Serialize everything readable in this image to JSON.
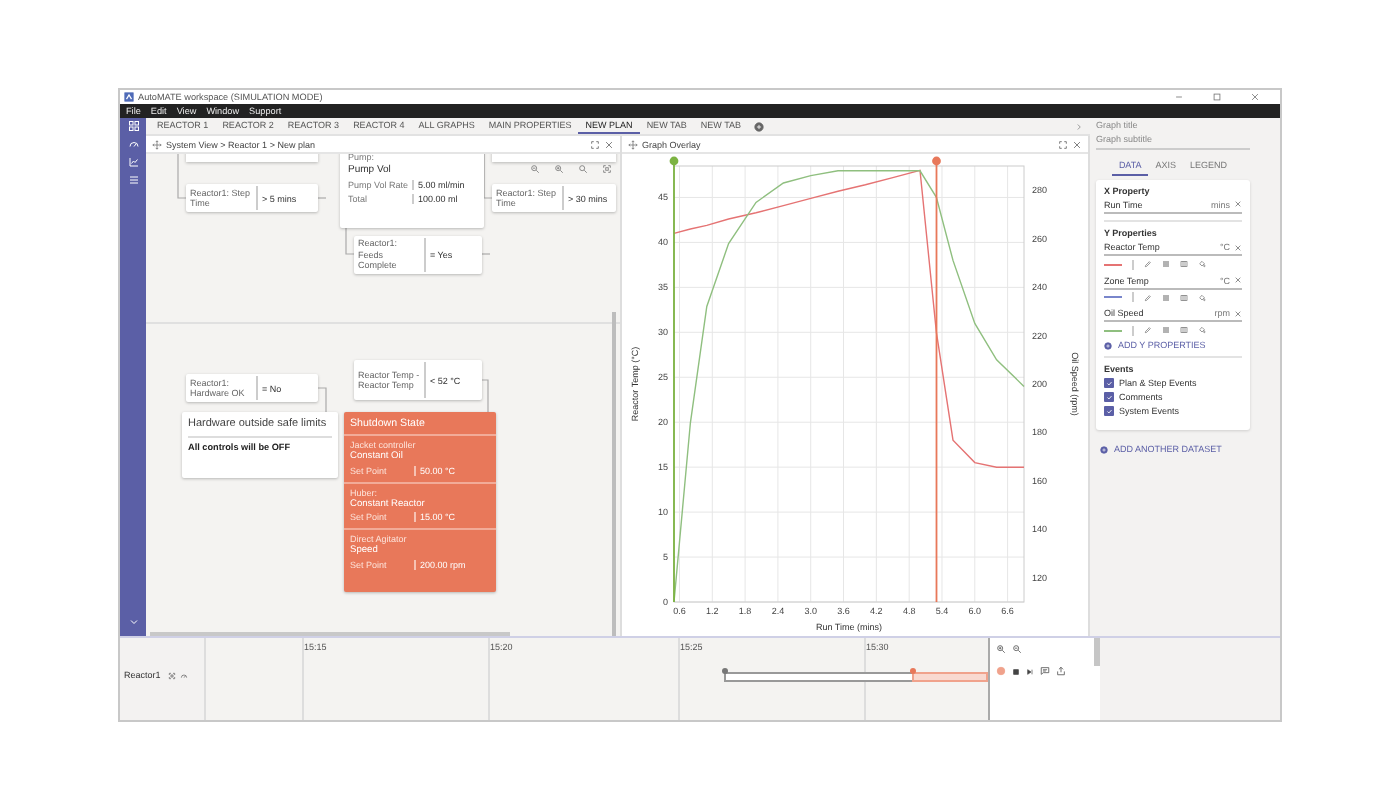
{
  "window": {
    "title": "AutoMATE workspace (SIMULATION MODE)"
  },
  "menu": [
    "File",
    "Edit",
    "View",
    "Window",
    "Support"
  ],
  "tabs": [
    {
      "label": "REACTOR 1",
      "selected": false
    },
    {
      "label": "REACTOR 2",
      "selected": false
    },
    {
      "label": "REACTOR 3",
      "selected": false
    },
    {
      "label": "REACTOR 4",
      "selected": false
    },
    {
      "label": "ALL GRAPHS",
      "selected": false
    },
    {
      "label": "MAIN PROPERTIES",
      "selected": false
    },
    {
      "label": "NEW PLAN",
      "selected": true
    },
    {
      "label": "NEW TAB",
      "selected": false
    },
    {
      "label": "NEW TAB",
      "selected": false
    }
  ],
  "plan": {
    "breadcrumb": "System View > Reactor 1 > New plan",
    "cards": [
      {
        "kind": "condition",
        "label": "Reactor1: Step Time",
        "value": "> 5 mins"
      },
      {
        "kind": "action",
        "title": "Pump:",
        "name": "Pump Vol",
        "rows": [
          {
            "label": "Pump Vol Rate",
            "value": "5.00 ml/min"
          },
          {
            "label": "Total",
            "value": "100.00 ml"
          }
        ]
      },
      {
        "kind": "condition",
        "label": "Reactor1: Step Time",
        "value": "> 30 mins"
      },
      {
        "kind": "condition",
        "label": "Reactor1: Feeds Complete",
        "value": "= Yes"
      },
      {
        "kind": "condition",
        "label": "Reactor1: Hardware OK",
        "value": "= No"
      },
      {
        "kind": "alert",
        "title": "Hardware outside safe limits",
        "note": "All controls will be OFF"
      },
      {
        "kind": "condition",
        "label": "Reactor Temp - Reactor Temp",
        "value": "< 52 °C"
      },
      {
        "kind": "state",
        "title": "Shutdown State",
        "sections": [
          {
            "device": "Jacket controller",
            "mode": "Constant Oil",
            "label": "Set Point",
            "value": "50.00 °C"
          },
          {
            "device": "Huber:",
            "mode": "Constant Reactor",
            "label": "Set Point",
            "value": "15.00 °C"
          },
          {
            "device": "Direct Agitator",
            "mode": "Speed",
            "label": "Set Point",
            "value": "200.00 rpm"
          }
        ]
      }
    ]
  },
  "graph": {
    "title": "Graph Overlay",
    "chart_data": {
      "type": "line",
      "xlabel": "Run Time (mins)",
      "ylabel": "Reactor Temp (°C)",
      "y2label": "Oil Speed (rpm)",
      "x": [
        0.5,
        0.8,
        1.1,
        1.5,
        2.0,
        2.5,
        3.0,
        3.5,
        4.0,
        4.5,
        5.0,
        5.3,
        5.6,
        6.0,
        6.4,
        6.9
      ],
      "series": [
        {
          "color": "#e57373",
          "values": [
            41,
            41.5,
            41.9,
            42.6,
            43.3,
            44.1,
            44.9,
            45.7,
            46.4,
            47.2,
            48,
            30,
            18,
            15.5,
            15,
            15
          ]
        },
        {
          "color": "#8fbf7f",
          "axis": "y2",
          "values": [
            110,
            184,
            232,
            258,
            275,
            283,
            286,
            288,
            288,
            288,
            288,
            277,
            251,
            225,
            210,
            199
          ]
        }
      ],
      "xlim": [
        0.5,
        6.9
      ],
      "ylim": [
        0,
        48.5
      ],
      "y2lim": [
        110,
        290
      ],
      "xticks": [
        0.6,
        1.2,
        1.8,
        2.4,
        {
          "value": 3,
          "label": "3.0"
        },
        3.6,
        4.2,
        4.8,
        5.4,
        {
          "value": 6,
          "label": "6.0"
        },
        6.6
      ],
      "yticks": [
        0,
        5,
        10,
        15,
        20,
        25,
        30,
        35,
        40,
        45
      ],
      "y2ticks": [
        120,
        140,
        160,
        180,
        200,
        220,
        240,
        260,
        280
      ],
      "grid": true
    }
  },
  "properties": {
    "title_placeholder": "Graph title",
    "subtitle_placeholder": "Graph subtitle",
    "tabs": [
      {
        "label": "DATA",
        "selected": true
      },
      {
        "label": "AXIS",
        "selected": false
      },
      {
        "label": "LEGEND",
        "selected": false
      }
    ],
    "x_heading": "X Property",
    "x_property": {
      "name": "Run Time",
      "unit": "mins"
    },
    "y_heading": "Y Properties",
    "y_properties": [
      {
        "name": "Reactor Temp",
        "unit": "°C",
        "color": "#e57373"
      },
      {
        "name": "Zone Temp",
        "unit": "°C",
        "color": "#7986cb"
      },
      {
        "name": "Oil Speed",
        "unit": "rpm",
        "color": "#8fbf7f"
      }
    ],
    "add_y": "ADD Y PROPERTIES",
    "events_heading": "Events",
    "events": [
      {
        "label": "Plan & Step Events",
        "checked": true
      },
      {
        "label": "Comments",
        "checked": true
      },
      {
        "label": "System Events",
        "checked": true
      }
    ],
    "add_dataset": "ADD ANOTHER DATASET"
  },
  "timeline": {
    "rows": [
      {
        "label": "Reactor1"
      }
    ],
    "ticks": [
      "15:15",
      "15:20",
      "15:25",
      "15:30"
    ]
  }
}
